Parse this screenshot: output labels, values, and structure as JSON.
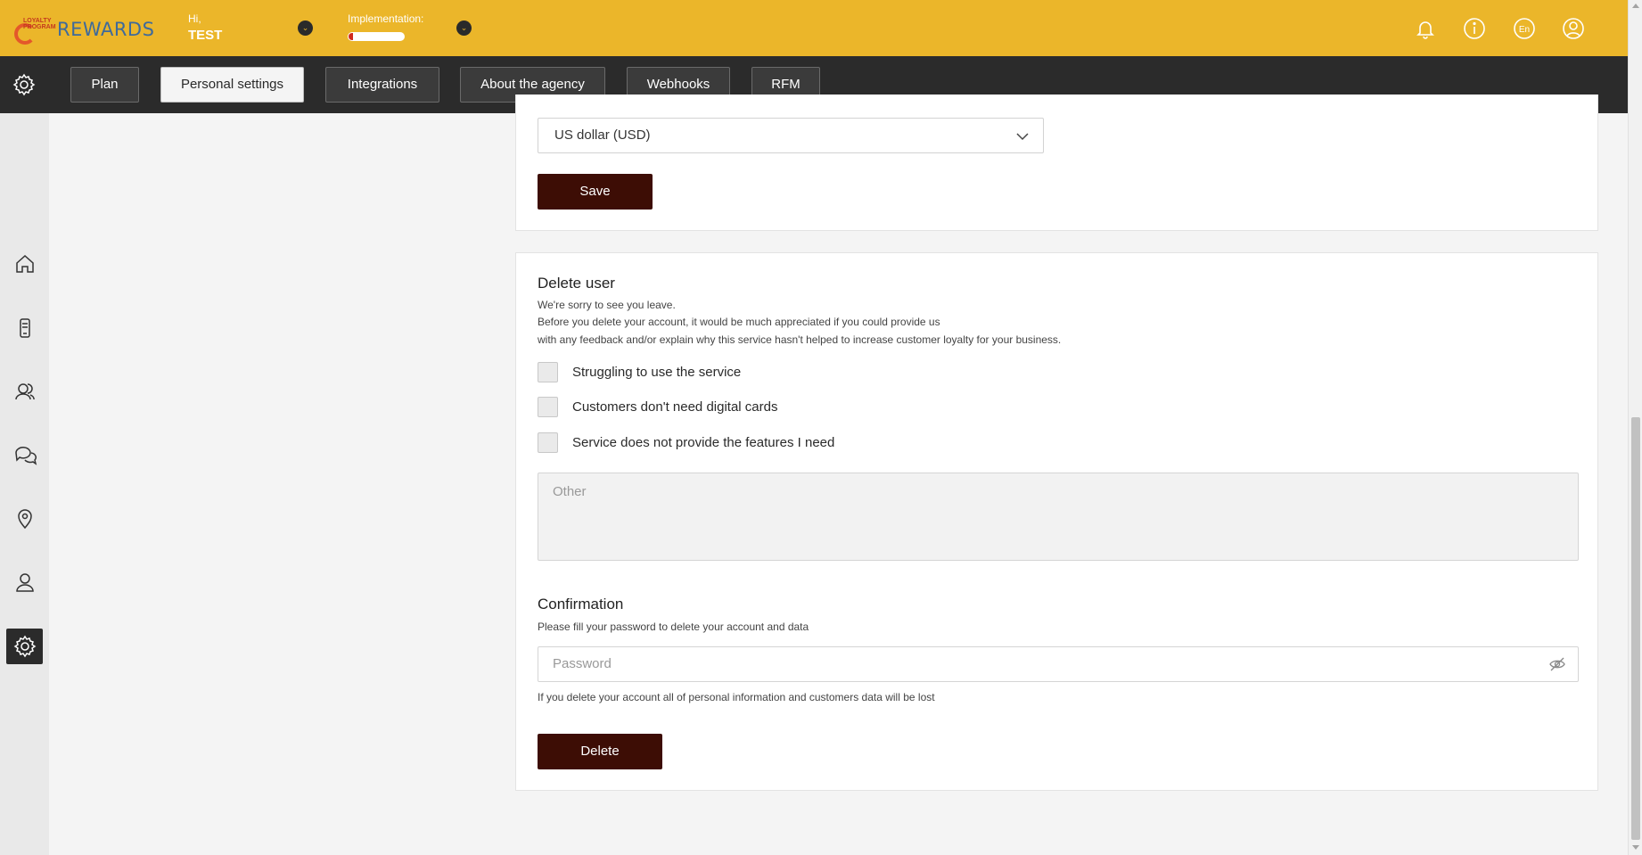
{
  "header": {
    "logo_text": "REWARDS",
    "logo_small_text": "LOYALTY PROGRAM",
    "greeting": "Hi,",
    "username": "TEST",
    "implementation_label": "Implementation:",
    "implementation_progress_percent": 8,
    "icons": [
      "bell-icon",
      "info-icon",
      "language-icon",
      "account-icon"
    ],
    "language_badge": "En"
  },
  "nav": {
    "tabs": [
      {
        "label": "Plan",
        "active": false
      },
      {
        "label": "Personal settings",
        "active": true
      },
      {
        "label": "Integrations",
        "active": false
      },
      {
        "label": "About the agency",
        "active": false
      },
      {
        "label": "Webhooks",
        "active": false
      },
      {
        "label": "RFM",
        "active": false
      }
    ]
  },
  "sidebar": {
    "items": [
      "home-icon",
      "device-icon",
      "customers-icon",
      "chat-icon",
      "location-icon",
      "user-icon",
      "settings-icon"
    ],
    "active": "settings-icon"
  },
  "currency": {
    "selected": "US dollar (USD)",
    "save_label": "Save"
  },
  "delete_user": {
    "title": "Delete user",
    "line1": "We're sorry to see you leave.",
    "line2": "Before you delete your account, it would be much appreciated if you could provide us",
    "line3": "with any feedback and/or explain why this service hasn't helped to increase customer loyalty for your business.",
    "reasons": [
      "Struggling to use the service",
      "Customers don't need digital cards",
      "Service does not provide the features I need"
    ],
    "other_placeholder": "Other",
    "confirmation_title": "Confirmation",
    "confirmation_hint": "Please fill your password to delete your account and data",
    "password_placeholder": "Password",
    "warning": "If you delete your account all of personal information and customers data will be lost",
    "delete_label": "Delete"
  },
  "colors": {
    "topbar": "#ebb62a",
    "navbar": "#2b2b2b",
    "button_dark": "#3d0d05"
  }
}
